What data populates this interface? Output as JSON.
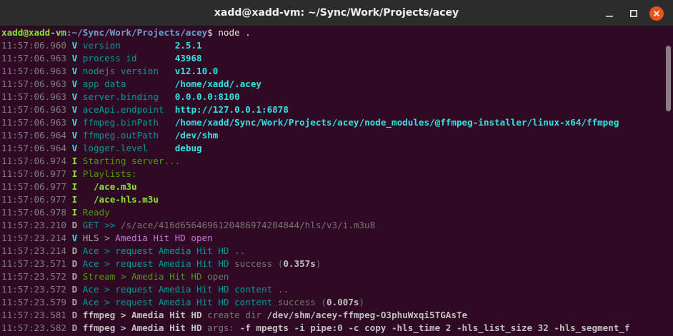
{
  "window": {
    "title": "xadd@xadd-vm: ~/Sync/Work/Projects/acey"
  },
  "prompt": {
    "user": "xadd@xadd-vm",
    "path": ":~/Sync/Work/Projects/acey",
    "symbol": "$",
    "command": " node ."
  },
  "log": [
    {
      "ts": "11:57:06.960",
      "lvl": "V",
      "key": "version         ",
      "val": "2.5.1"
    },
    {
      "ts": "11:57:06.963",
      "lvl": "V",
      "key": "process id      ",
      "val": "43968"
    },
    {
      "ts": "11:57:06.963",
      "lvl": "V",
      "key": "nodejs version  ",
      "val": "v12.10.0"
    },
    {
      "ts": "11:57:06.963",
      "lvl": "V",
      "key": "app data        ",
      "val": "/home/xadd/.acey"
    },
    {
      "ts": "11:57:06.963",
      "lvl": "V",
      "key": "server.binding  ",
      "val": "0.0.0.0:8100"
    },
    {
      "ts": "11:57:06.963",
      "lvl": "V",
      "key": "aceApi.endpoint ",
      "val": "http://127.0.0.1:6878"
    },
    {
      "ts": "11:57:06.963",
      "lvl": "V",
      "key": "ffmpeg.binPath  ",
      "val": "/home/xadd/Sync/Work/Projects/acey/node_modules/@ffmpeg-installer/linux-x64/ffmpeg"
    },
    {
      "ts": "11:57:06.964",
      "lvl": "V",
      "key": "ffmpeg.outPath  ",
      "val": "/dev/shm"
    },
    {
      "ts": "11:57:06.964",
      "lvl": "V",
      "key": "logger.level    ",
      "val": "debug"
    },
    {
      "ts": "11:57:06.974",
      "lvl": "I",
      "text": "Starting server..."
    },
    {
      "ts": "11:57:06.977",
      "lvl": "I",
      "text": "Playlists:"
    },
    {
      "ts": "11:57:06.977",
      "lvl": "I",
      "item": "  /ace.m3u"
    },
    {
      "ts": "11:57:06.977",
      "lvl": "I",
      "item": "  /ace-hls.m3u"
    },
    {
      "ts": "11:57:06.978",
      "lvl": "I",
      "text": "Ready"
    },
    {
      "ts": "11:57:23.210",
      "lvl": "D",
      "a": "GET >> ",
      "b": "/s/ace/416d6564696120486974204844/hls/v3/i.m3u8"
    },
    {
      "ts": "11:57:23.214",
      "lvl": "V",
      "a": "HLS > ",
      "b": "Amedia Hit HD open"
    },
    {
      "ts": "11:57:23.214",
      "lvl": "D",
      "a": "Ace > request Amedia Hit HD",
      "b": " .."
    },
    {
      "ts": "11:57:23.571",
      "lvl": "D",
      "a": "Ace > request Amedia Hit HD",
      "b": " success (",
      "c": "0.357s",
      "d": ")"
    },
    {
      "ts": "11:57:23.572",
      "lvl": "D",
      "a": "Stream > Amedia Hit HD",
      "b": " open"
    },
    {
      "ts": "11:57:23.572",
      "lvl": "D",
      "a": "Ace > request Amedia Hit HD content",
      "b": " .."
    },
    {
      "ts": "11:57:23.579",
      "lvl": "D",
      "a": "Ace > request Amedia Hit HD content",
      "b": " success (",
      "c": "0.007s",
      "d": ")"
    },
    {
      "ts": "11:57:23.581",
      "lvl": "D",
      "a": "ffmpeg > Amedia Hit HD",
      "b": " create dir ",
      "c": "/dev/shm/acey-ffmpeg-O3phuWxqi5TGAsTe"
    },
    {
      "ts": "11:57:23.582",
      "lvl": "D",
      "a": "ffmpeg > Amedia Hit HD",
      "b": " args: ",
      "c": "-f mpegts -i pipe:0 -c copy -hls_time 2 -hls_list_size 32 -hls_segment_f"
    }
  ]
}
